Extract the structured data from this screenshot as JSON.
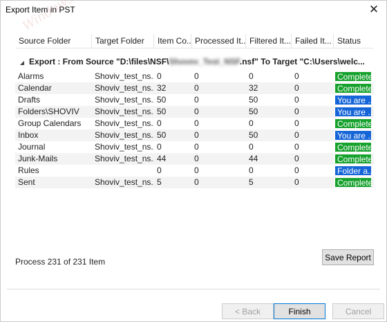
{
  "window": {
    "title": "Export Item in PST",
    "close_glyph": "✕"
  },
  "watermark": {
    "text": "Windows PC",
    "sub": "Wonders"
  },
  "table": {
    "columns": [
      "Source Folder",
      "Target Folder",
      "Item Co...",
      "Processed It...",
      "Filtered It...",
      "Failed It...",
      "Status"
    ],
    "group": {
      "caret": "◢",
      "prefix": "Export : From Source \"D:\\files\\NSF\\",
      "blurred_name": "Shovev_Test_NSF",
      "suffix": ".nsf\" To Target \"C:\\Users\\welc..."
    },
    "rows": [
      {
        "source": "Alarms",
        "target": "Shoviv_test_ns...",
        "items": "0",
        "processed": "0",
        "filtered": "0",
        "failed": "0",
        "status": "Completed",
        "status_color": "#16a12d"
      },
      {
        "source": "Calendar",
        "target": "Shoviv_test_ns...",
        "items": "32",
        "processed": "0",
        "filtered": "32",
        "failed": "0",
        "status": "Completed",
        "status_color": "#16a12d"
      },
      {
        "source": "Drafts",
        "target": "Shoviv_test_ns...",
        "items": "50",
        "processed": "0",
        "filtered": "50",
        "failed": "0",
        "status": "You are ...",
        "status_color": "#1565d8"
      },
      {
        "source": "Folders\\SHOVIV",
        "target": "Shoviv_test_ns...",
        "items": "50",
        "processed": "0",
        "filtered": "50",
        "failed": "0",
        "status": "You are ...",
        "status_color": "#1565d8"
      },
      {
        "source": "Group Calendars",
        "target": "Shoviv_test_ns...",
        "items": "0",
        "processed": "0",
        "filtered": "0",
        "failed": "0",
        "status": "Completed",
        "status_color": "#16a12d"
      },
      {
        "source": "Inbox",
        "target": "Shoviv_test_ns...",
        "items": "50",
        "processed": "0",
        "filtered": "50",
        "failed": "0",
        "status": "You are ...",
        "status_color": "#1565d8"
      },
      {
        "source": "Journal",
        "target": "Shoviv_test_ns...",
        "items": "0",
        "processed": "0",
        "filtered": "0",
        "failed": "0",
        "status": "Completed",
        "status_color": "#16a12d"
      },
      {
        "source": "Junk-Mails",
        "target": "Shoviv_test_ns...",
        "items": "44",
        "processed": "0",
        "filtered": "44",
        "failed": "0",
        "status": "Completed",
        "status_color": "#16a12d"
      },
      {
        "source": "Rules",
        "target": "",
        "items": "0",
        "processed": "0",
        "filtered": "0",
        "failed": "0",
        "status": "Folder a...",
        "status_color": "#1565d8"
      },
      {
        "source": "Sent",
        "target": "Shoviv_test_ns...",
        "items": "5",
        "processed": "0",
        "filtered": "5",
        "failed": "0",
        "status": "Completed",
        "status_color": "#16a12d"
      }
    ]
  },
  "footer": {
    "process_text": "Process 231 of 231 Item",
    "save_report": "Save Report",
    "back": "< Back",
    "finish": "Finish",
    "cancel": "Cancel"
  }
}
